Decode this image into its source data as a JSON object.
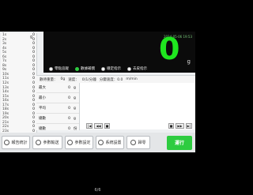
{
  "left_list": [
    {
      "label": "1s",
      "value": "0"
    },
    {
      "label": "2s",
      "value": "0"
    },
    {
      "label": "3s",
      "value": "0"
    },
    {
      "label": "4s",
      "value": "0"
    },
    {
      "label": "5s",
      "value": "0"
    },
    {
      "label": "6s",
      "value": "0"
    },
    {
      "label": "7s",
      "value": "0"
    },
    {
      "label": "8s",
      "value": "0"
    },
    {
      "label": "9s",
      "value": "0"
    },
    {
      "label": "10s",
      "value": "0"
    },
    {
      "label": "11s",
      "value": "0"
    },
    {
      "label": "12s",
      "value": "0"
    },
    {
      "label": "13s",
      "value": "0"
    },
    {
      "label": "14s",
      "value": "0"
    },
    {
      "label": "15s",
      "value": "0"
    },
    {
      "label": "16s",
      "value": "0"
    },
    {
      "label": "17s",
      "value": "0"
    },
    {
      "label": "18s",
      "value": "0"
    },
    {
      "label": "19s",
      "value": "0"
    },
    {
      "label": "20s",
      "value": "0"
    },
    {
      "label": "21s",
      "value": "0"
    },
    {
      "label": "22s",
      "value": "0"
    },
    {
      "label": "23s",
      "value": "0"
    },
    {
      "label": "24s",
      "value": "0"
    },
    {
      "label": "25s",
      "value": "0"
    },
    {
      "label": "26s",
      "value": "0"
    }
  ],
  "unit_small": "g",
  "display": {
    "top_text": "2024-05-06 19:53",
    "value": "0",
    "unit": "g"
  },
  "modes": [
    {
      "label": "零點追蹤",
      "on": false
    },
    {
      "label": "數據補償",
      "on": true
    },
    {
      "label": "穩定指示",
      "on": false
    },
    {
      "label": "去皮指示",
      "on": false
    }
  ],
  "info": {
    "a": "數待重量：",
    "a_val": "0g",
    "b": "速度：",
    "b_val": "0(1/分鐘",
    "c": "分變速度：0.0",
    "c_unit": "m/min"
  },
  "stats": [
    {
      "label": "最大",
      "value": "0",
      "unit": "g"
    },
    {
      "label": "最小",
      "value": "0",
      "unit": "g"
    },
    {
      "label": "平均",
      "value": "0",
      "unit": "g"
    },
    {
      "label": "總數",
      "value": "0",
      "unit": "g"
    },
    {
      "label": "總數",
      "value": "0",
      "unit": "份"
    }
  ],
  "player": {
    "first": "|◀",
    "prev": "◀◀",
    "stop": "■",
    "play": "▶▶",
    "last": "▶|"
  },
  "toolbar": [
    {
      "label": "報告統計"
    },
    {
      "label": "參數輸送"
    },
    {
      "label": "參數設定"
    },
    {
      "label": "系統設置"
    },
    {
      "label": "歸零"
    }
  ],
  "run_label": "運行",
  "page_num": "6/6"
}
